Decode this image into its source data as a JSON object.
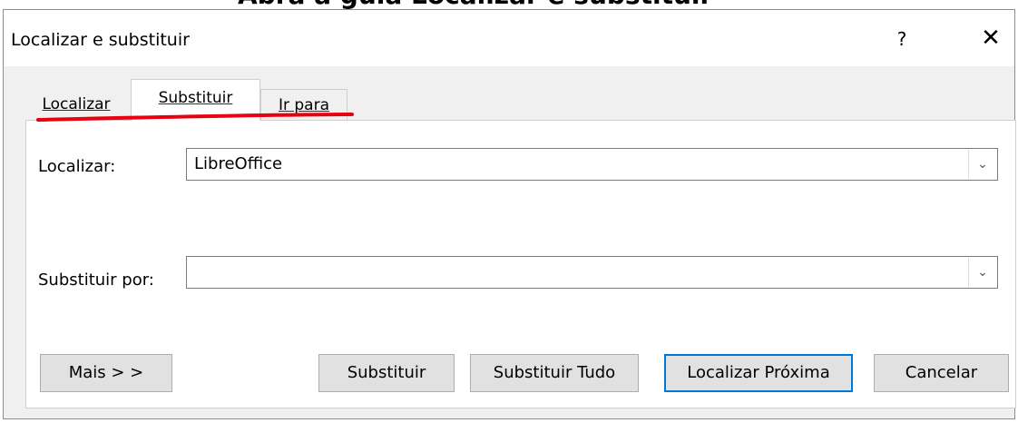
{
  "caption_fragment": "Abra a guia Localizar e substituir",
  "dialog": {
    "title": "Localizar e substituir",
    "help_glyph": "?",
    "close_glyph": "✕"
  },
  "tabs": [
    {
      "label": "Localizar",
      "active": false
    },
    {
      "label": "Substituir",
      "active": true
    },
    {
      "label": "Ir para",
      "active": false
    }
  ],
  "annotation": {
    "color": "#e8000e"
  },
  "find": {
    "label": "Localizar:",
    "value": "LibreOffice"
  },
  "replace": {
    "label": "Substituir por:",
    "value": ""
  },
  "buttons": {
    "more": "Mais > >",
    "replace": "Substituir",
    "replace_all": "Substituir Tudo",
    "find_next": "Localizar Próxima",
    "cancel": "Cancelar"
  },
  "colors": {
    "dialog_bg": "#f0f0f0",
    "focus_border": "#0078d7",
    "button_bg": "#e1e1e1"
  }
}
